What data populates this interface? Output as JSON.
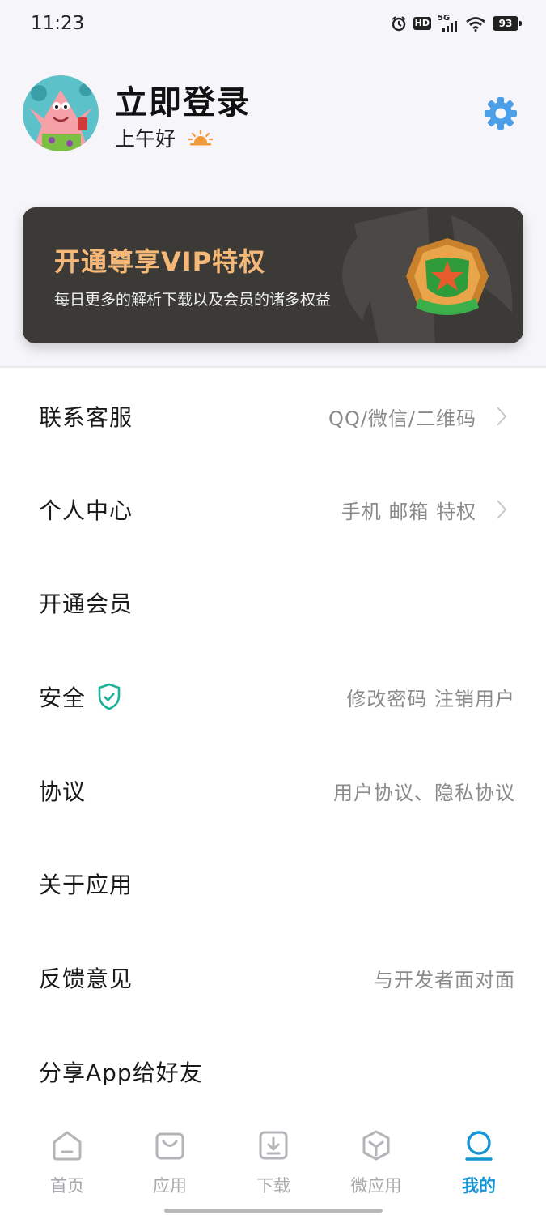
{
  "status_bar": {
    "time": "11:23",
    "network": "5G",
    "hd": "HD",
    "battery": "93"
  },
  "profile": {
    "title": "立即登录",
    "greeting": "上午好"
  },
  "vip": {
    "title": "开通尊享VIP特权",
    "subtitle": "每日更多的解析下载以及会员的诸多权益"
  },
  "menu": [
    {
      "label": "联系客服",
      "hint": "QQ/微信/二维码"
    },
    {
      "label": "个人中心",
      "hint": "手机 邮箱 特权"
    },
    {
      "label": "开通会员",
      "hint": ""
    },
    {
      "label": "安全",
      "hint": "修改密码  注销用户"
    },
    {
      "label": "协议",
      "hint": "用户协议、隐私协议"
    },
    {
      "label": "关于应用",
      "hint": ""
    },
    {
      "label": "反馈意见",
      "hint": "与开发者面对面"
    },
    {
      "label": "分享App给好友",
      "hint": ""
    }
  ],
  "nav": [
    {
      "label": "首页",
      "icon": "home-icon"
    },
    {
      "label": "应用",
      "icon": "bag-icon"
    },
    {
      "label": "下载",
      "icon": "download-icon"
    },
    {
      "label": "微应用",
      "icon": "cube-icon"
    },
    {
      "label": "我的",
      "icon": "profile-icon",
      "active": true
    }
  ],
  "colors": {
    "accent": "#1595d6",
    "vip_gold": "#f5b877",
    "safe_green": "#19b39a",
    "settings_blue": "#4a9fe8"
  }
}
